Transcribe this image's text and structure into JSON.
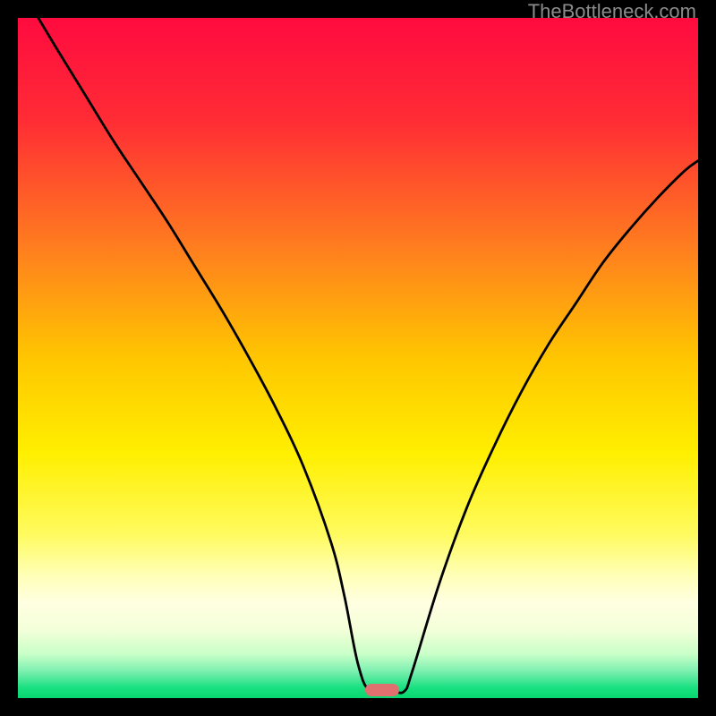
{
  "watermark": "TheBottleneck.com",
  "chart_data": {
    "type": "line",
    "title": "",
    "xlabel": "",
    "ylabel": "",
    "xlim": [
      0,
      100
    ],
    "ylim": [
      0,
      100
    ],
    "background_gradient": {
      "stops": [
        {
          "offset": 0.0,
          "color": "#ff0b3f"
        },
        {
          "offset": 0.15,
          "color": "#ff2c35"
        },
        {
          "offset": 0.33,
          "color": "#ff7a20"
        },
        {
          "offset": 0.5,
          "color": "#ffc600"
        },
        {
          "offset": 0.64,
          "color": "#ffef00"
        },
        {
          "offset": 0.76,
          "color": "#fffb60"
        },
        {
          "offset": 0.82,
          "color": "#ffffb8"
        },
        {
          "offset": 0.86,
          "color": "#ffffe2"
        },
        {
          "offset": 0.9,
          "color": "#f3ffd8"
        },
        {
          "offset": 0.935,
          "color": "#c9ffc9"
        },
        {
          "offset": 0.96,
          "color": "#7ef0b0"
        },
        {
          "offset": 0.985,
          "color": "#18e080"
        },
        {
          "offset": 1.0,
          "color": "#08d66f"
        }
      ]
    },
    "series": [
      {
        "name": "curve",
        "color": "#000000",
        "x": [
          3,
          6,
          10,
          14,
          18,
          22,
          26,
          30,
          34,
          38,
          42,
          46,
          48,
          50,
          51.8,
          55,
          56.8,
          58,
          62,
          66,
          70,
          74,
          78,
          82,
          86,
          90,
          94,
          98,
          100
        ],
        "y": [
          100,
          95,
          88.5,
          82,
          76,
          70,
          63.5,
          57,
          50,
          42.5,
          34,
          23,
          15,
          5,
          1.0,
          1.0,
          1.0,
          4,
          17,
          28,
          37,
          45,
          52,
          58,
          64,
          69,
          73.5,
          77.5,
          79
        ]
      }
    ],
    "marker": {
      "x": 53.5,
      "y": 1.2,
      "color": "#e07070"
    }
  }
}
